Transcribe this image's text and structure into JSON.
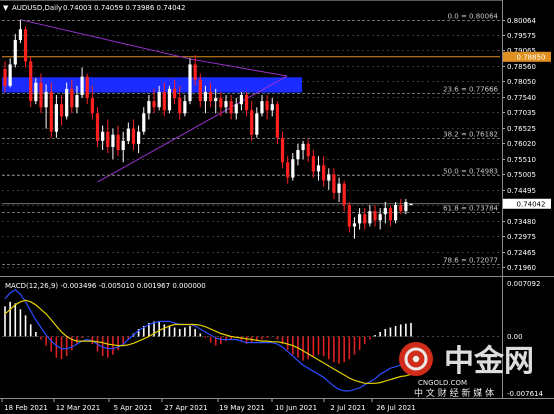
{
  "header": {
    "symbol": "AUDUSD,Daily",
    "ohlc": "0.74003 0.74059 0.73986 0.74042"
  },
  "macd": {
    "label": "MACD(12,26,9) -0.003496 -0.005010 0.001967 0.000000",
    "histogram": [
      0.004,
      0.0046,
      0.0044,
      0.0036,
      0.0028,
      0.0016,
      0.0006,
      -0.0004,
      -0.0012,
      -0.002,
      -0.0028,
      -0.003,
      -0.0026,
      -0.0018,
      -0.001,
      -0.0002,
      0.0,
      -0.001,
      -0.002,
      -0.0026,
      -0.0028,
      -0.0024,
      -0.0018,
      -0.0012,
      -0.0004,
      0.0004,
      0.001,
      0.0014,
      0.0018,
      0.002,
      0.002,
      0.0016,
      0.0014,
      0.0012,
      0.001,
      0.0012,
      0.0014,
      0.001,
      0.0004,
      -0.0002,
      -0.0008,
      -0.0012,
      -0.001,
      -0.0006,
      -0.0004,
      -0.0002,
      -0.0006,
      -0.001,
      -0.0008,
      -0.0006,
      -0.0004,
      -0.0002,
      0.0,
      -0.0004,
      -0.001,
      -0.0018,
      -0.0024,
      -0.0028,
      -0.0032,
      -0.003,
      -0.0026,
      -0.0024,
      -0.0026,
      -0.003,
      -0.0034,
      -0.0036,
      -0.0034,
      -0.003,
      -0.0024,
      -0.0018,
      -0.001,
      -0.0004,
      0.0002,
      0.0006,
      0.001,
      0.0012,
      0.0014,
      0.0016,
      0.0017,
      0.0018
    ],
    "macd_line": [
      0.005,
      0.0058,
      0.0062,
      0.0056,
      0.0046,
      0.0034,
      0.0022,
      0.0012,
      0.0002,
      -0.0006,
      -0.0012,
      -0.0016,
      -0.0016,
      -0.0014,
      -0.001,
      -0.0006,
      -0.0004,
      -0.0006,
      -0.001,
      -0.0014,
      -0.0016,
      -0.0016,
      -0.0014,
      -0.001,
      -0.0004,
      0.0002,
      0.0008,
      0.0012,
      0.0016,
      0.0018,
      0.002,
      0.002,
      0.002,
      0.0018,
      0.0016,
      0.0016,
      0.0016,
      0.0014,
      0.001,
      0.0006,
      0.0002,
      -0.0002,
      -0.0004,
      -0.0004,
      -0.0004,
      -0.0004,
      -0.0006,
      -0.0008,
      -0.0008,
      -0.0008,
      -0.0008,
      -0.0008,
      -0.0008,
      -0.001,
      -0.0014,
      -0.002,
      -0.0026,
      -0.0032,
      -0.0038,
      -0.0042,
      -0.0046,
      -0.005,
      -0.0054,
      -0.006,
      -0.0066,
      -0.007,
      -0.0072,
      -0.0072,
      -0.007,
      -0.0068,
      -0.0064,
      -0.006,
      -0.0056,
      -0.005,
      -0.0046,
      -0.0042,
      -0.004,
      -0.0038,
      -0.0036,
      -0.0035
    ],
    "signal_line": [
      0.003,
      0.0036,
      0.0042,
      0.0046,
      0.0048,
      0.0046,
      0.0042,
      0.0036,
      0.003,
      0.0022,
      0.0014,
      0.0006,
      0.0,
      -0.0004,
      -0.0006,
      -0.0006,
      -0.0006,
      -0.0006,
      -0.0007,
      -0.0008,
      -0.001,
      -0.0011,
      -0.0012,
      -0.0012,
      -0.0011,
      -0.0009,
      -0.0006,
      -0.0003,
      0.0,
      0.0004,
      0.0008,
      0.0011,
      0.0014,
      0.0016,
      0.0016,
      0.0016,
      0.0016,
      0.0016,
      0.0015,
      0.0013,
      0.001,
      0.0007,
      0.0004,
      0.0002,
      0.0,
      -0.0001,
      -0.0002,
      -0.0003,
      -0.0004,
      -0.0005,
      -0.0006,
      -0.0006,
      -0.0007,
      -0.0007,
      -0.0008,
      -0.001,
      -0.0012,
      -0.0015,
      -0.0019,
      -0.0023,
      -0.0027,
      -0.0031,
      -0.0035,
      -0.0039,
      -0.0043,
      -0.0047,
      -0.0051,
      -0.0055,
      -0.0058,
      -0.006,
      -0.0062,
      -0.0062,
      -0.0062,
      -0.0061,
      -0.0059,
      -0.0057,
      -0.0055,
      -0.0053,
      -0.0052,
      -0.005
    ],
    "price_labels": {
      "top": "0.007092",
      "zero": "0.00",
      "bottom": "-0.007614"
    },
    "range": [
      -0.007614,
      0.007092
    ]
  },
  "price_axis": {
    "range": [
      0.71875,
      0.8025
    ],
    "labels": [
      "0.80064",
      "0.79575",
      "0.79065",
      "0.78560",
      "0.78050",
      "0.77540",
      "0.77035",
      "0.76525",
      "0.76020",
      "0.75510",
      "0.75005",
      "0.74495",
      "0.73990",
      "0.73480",
      "0.72975",
      "0.72465",
      "0.71960"
    ],
    "current_price": "0.74042",
    "level_price": "0.78850",
    "level_color": "#e09020",
    "current_color": "#ffffff"
  },
  "fib_levels": [
    {
      "label": "0.0 = 0.80064",
      "price": 0.80064
    },
    {
      "label": "23.6 = 0.77666",
      "price": 0.77666
    },
    {
      "label": "38.2 = 0.76182",
      "price": 0.76182
    },
    {
      "label": "50.0 = 0.74983",
      "price": 0.74983
    },
    {
      "label": "61.8 = 0.73784",
      "price": 0.73784
    },
    {
      "label": "78.6 = 0.72077",
      "price": 0.72077
    }
  ],
  "resistance_zone": {
    "top": 0.7818,
    "bottom": 0.7768,
    "color": "#1a2cff"
  },
  "triangle": {
    "color": "#9b30d0",
    "apex_price": 0.7822,
    "upper_start_price": 0.80064,
    "lower_start_price": 0.7475,
    "mid_price": 0.7878
  },
  "x_axis": [
    "18 Feb 2021",
    "12 Mar 2021",
    "5 Apr 2021",
    "27 Apr 2021",
    "19 May 2021",
    "10 Jun 2021",
    "2 Jul 2021",
    "26 Jul 2021"
  ],
  "candle_colors": {
    "bull": "#ffffff",
    "bear": "#ff2020"
  },
  "candles": [
    {
      "o": 0.7845,
      "h": 0.787,
      "l": 0.777,
      "c": 0.779
    },
    {
      "o": 0.779,
      "h": 0.788,
      "l": 0.7785,
      "c": 0.786
    },
    {
      "o": 0.786,
      "h": 0.796,
      "l": 0.785,
      "c": 0.794
    },
    {
      "o": 0.794,
      "h": 0.8006,
      "l": 0.793,
      "c": 0.7975
    },
    {
      "o": 0.7975,
      "h": 0.7985,
      "l": 0.785,
      "c": 0.787
    },
    {
      "o": 0.787,
      "h": 0.7885,
      "l": 0.772,
      "c": 0.774
    },
    {
      "o": 0.774,
      "h": 0.7815,
      "l": 0.773,
      "c": 0.78
    },
    {
      "o": 0.78,
      "h": 0.783,
      "l": 0.77,
      "c": 0.772
    },
    {
      "o": 0.772,
      "h": 0.7795,
      "l": 0.765,
      "c": 0.777
    },
    {
      "o": 0.777,
      "h": 0.78,
      "l": 0.762,
      "c": 0.764
    },
    {
      "o": 0.764,
      "h": 0.776,
      "l": 0.762,
      "c": 0.773
    },
    {
      "o": 0.773,
      "h": 0.776,
      "l": 0.766,
      "c": 0.769
    },
    {
      "o": 0.769,
      "h": 0.78,
      "l": 0.768,
      "c": 0.778
    },
    {
      "o": 0.778,
      "h": 0.781,
      "l": 0.77,
      "c": 0.772
    },
    {
      "o": 0.772,
      "h": 0.779,
      "l": 0.77,
      "c": 0.776
    },
    {
      "o": 0.776,
      "h": 0.785,
      "l": 0.775,
      "c": 0.782
    },
    {
      "o": 0.782,
      "h": 0.783,
      "l": 0.773,
      "c": 0.775
    },
    {
      "o": 0.775,
      "h": 0.779,
      "l": 0.768,
      "c": 0.77
    },
    {
      "o": 0.77,
      "h": 0.772,
      "l": 0.759,
      "c": 0.761
    },
    {
      "o": 0.761,
      "h": 0.766,
      "l": 0.758,
      "c": 0.764
    },
    {
      "o": 0.764,
      "h": 0.768,
      "l": 0.757,
      "c": 0.759
    },
    {
      "o": 0.759,
      "h": 0.765,
      "l": 0.755,
      "c": 0.763
    },
    {
      "o": 0.763,
      "h": 0.766,
      "l": 0.756,
      "c": 0.758
    },
    {
      "o": 0.758,
      "h": 0.764,
      "l": 0.754,
      "c": 0.761
    },
    {
      "o": 0.761,
      "h": 0.767,
      "l": 0.76,
      "c": 0.765
    },
    {
      "o": 0.765,
      "h": 0.768,
      "l": 0.758,
      "c": 0.76
    },
    {
      "o": 0.76,
      "h": 0.766,
      "l": 0.757,
      "c": 0.764
    },
    {
      "o": 0.764,
      "h": 0.772,
      "l": 0.763,
      "c": 0.77
    },
    {
      "o": 0.77,
      "h": 0.776,
      "l": 0.768,
      "c": 0.774
    },
    {
      "o": 0.774,
      "h": 0.778,
      "l": 0.77,
      "c": 0.772
    },
    {
      "o": 0.772,
      "h": 0.779,
      "l": 0.771,
      "c": 0.777
    },
    {
      "o": 0.777,
      "h": 0.78,
      "l": 0.769,
      "c": 0.771
    },
    {
      "o": 0.771,
      "h": 0.779,
      "l": 0.77,
      "c": 0.778
    },
    {
      "o": 0.778,
      "h": 0.781,
      "l": 0.773,
      "c": 0.775
    },
    {
      "o": 0.775,
      "h": 0.779,
      "l": 0.768,
      "c": 0.77
    },
    {
      "o": 0.77,
      "h": 0.776,
      "l": 0.769,
      "c": 0.774
    },
    {
      "o": 0.774,
      "h": 0.788,
      "l": 0.773,
      "c": 0.786
    },
    {
      "o": 0.786,
      "h": 0.789,
      "l": 0.779,
      "c": 0.781
    },
    {
      "o": 0.781,
      "h": 0.783,
      "l": 0.772,
      "c": 0.774
    },
    {
      "o": 0.774,
      "h": 0.779,
      "l": 0.77,
      "c": 0.777
    },
    {
      "o": 0.777,
      "h": 0.78,
      "l": 0.772,
      "c": 0.774
    },
    {
      "o": 0.774,
      "h": 0.778,
      "l": 0.77,
      "c": 0.775
    },
    {
      "o": 0.775,
      "h": 0.777,
      "l": 0.769,
      "c": 0.772
    },
    {
      "o": 0.772,
      "h": 0.776,
      "l": 0.77,
      "c": 0.774
    },
    {
      "o": 0.774,
      "h": 0.776,
      "l": 0.768,
      "c": 0.77
    },
    {
      "o": 0.77,
      "h": 0.775,
      "l": 0.768,
      "c": 0.773
    },
    {
      "o": 0.773,
      "h": 0.777,
      "l": 0.771,
      "c": 0.776
    },
    {
      "o": 0.776,
      "h": 0.777,
      "l": 0.769,
      "c": 0.771
    },
    {
      "o": 0.771,
      "h": 0.774,
      "l": 0.761,
      "c": 0.763
    },
    {
      "o": 0.763,
      "h": 0.772,
      "l": 0.762,
      "c": 0.77
    },
    {
      "o": 0.77,
      "h": 0.776,
      "l": 0.769,
      "c": 0.774
    },
    {
      "o": 0.774,
      "h": 0.776,
      "l": 0.768,
      "c": 0.771
    },
    {
      "o": 0.771,
      "h": 0.775,
      "l": 0.769,
      "c": 0.773
    },
    {
      "o": 0.773,
      "h": 0.774,
      "l": 0.76,
      "c": 0.762
    },
    {
      "o": 0.762,
      "h": 0.764,
      "l": 0.752,
      "c": 0.754
    },
    {
      "o": 0.754,
      "h": 0.756,
      "l": 0.747,
      "c": 0.749
    },
    {
      "o": 0.749,
      "h": 0.757,
      "l": 0.748,
      "c": 0.755
    },
    {
      "o": 0.755,
      "h": 0.76,
      "l": 0.753,
      "c": 0.758
    },
    {
      "o": 0.758,
      "h": 0.761,
      "l": 0.755,
      "c": 0.76
    },
    {
      "o": 0.76,
      "h": 0.7615,
      "l": 0.754,
      "c": 0.756
    },
    {
      "o": 0.756,
      "h": 0.758,
      "l": 0.749,
      "c": 0.751
    },
    {
      "o": 0.751,
      "h": 0.756,
      "l": 0.748,
      "c": 0.753
    },
    {
      "o": 0.753,
      "h": 0.756,
      "l": 0.746,
      "c": 0.748
    },
    {
      "o": 0.748,
      "h": 0.752,
      "l": 0.745,
      "c": 0.75
    },
    {
      "o": 0.75,
      "h": 0.752,
      "l": 0.742,
      "c": 0.744
    },
    {
      "o": 0.744,
      "h": 0.749,
      "l": 0.741,
      "c": 0.747
    },
    {
      "o": 0.747,
      "h": 0.748,
      "l": 0.738,
      "c": 0.74
    },
    {
      "o": 0.74,
      "h": 0.741,
      "l": 0.731,
      "c": 0.733
    },
    {
      "o": 0.733,
      "h": 0.736,
      "l": 0.729,
      "c": 0.734
    },
    {
      "o": 0.734,
      "h": 0.739,
      "l": 0.732,
      "c": 0.737
    },
    {
      "o": 0.737,
      "h": 0.739,
      "l": 0.732,
      "c": 0.734
    },
    {
      "o": 0.734,
      "h": 0.74,
      "l": 0.733,
      "c": 0.738
    },
    {
      "o": 0.738,
      "h": 0.74,
      "l": 0.733,
      "c": 0.735
    },
    {
      "o": 0.735,
      "h": 0.739,
      "l": 0.732,
      "c": 0.737
    },
    {
      "o": 0.737,
      "h": 0.741,
      "l": 0.734,
      "c": 0.739
    },
    {
      "o": 0.739,
      "h": 0.74,
      "l": 0.733,
      "c": 0.735
    },
    {
      "o": 0.735,
      "h": 0.741,
      "l": 0.734,
      "c": 0.74
    },
    {
      "o": 0.74,
      "h": 0.742,
      "l": 0.737,
      "c": 0.738
    },
    {
      "o": 0.738,
      "h": 0.742,
      "l": 0.737,
      "c": 0.741
    },
    {
      "o": 0.74,
      "h": 0.7406,
      "l": 0.7399,
      "c": 0.7404
    }
  ],
  "watermark": {
    "brand": "中金网",
    "domain": "CNGOLD.COM",
    "slogan": "中 文 财 经 新 媒 体"
  }
}
